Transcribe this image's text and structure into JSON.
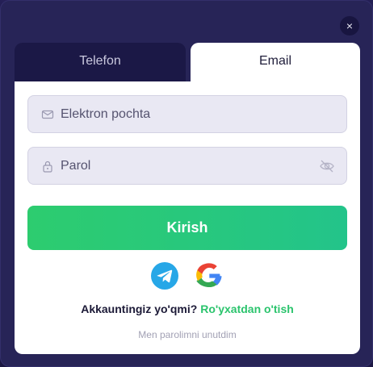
{
  "modal": {
    "close_symbol": "×"
  },
  "tabs": [
    {
      "label": "Telefon",
      "active": false
    },
    {
      "label": "Email",
      "active": true
    }
  ],
  "form": {
    "email_placeholder": "Elektron pochta",
    "email_icon": "envelope-icon",
    "password_placeholder": "Parol",
    "password_icon": "lock-icon",
    "password_toggle_icon": "eye-off-icon",
    "submit_label": "Kirish"
  },
  "social": {
    "providers": [
      "telegram",
      "google"
    ]
  },
  "signup": {
    "question": "Akkauntingiz yo'qmi?",
    "link_label": "Ro'yxatdan o'tish"
  },
  "forgot_password": "Men parolimni unutdim",
  "colors": {
    "accent_green": "#2bc46d",
    "modal_bg": "#272457",
    "telegram_blue": "#27a7e7"
  }
}
